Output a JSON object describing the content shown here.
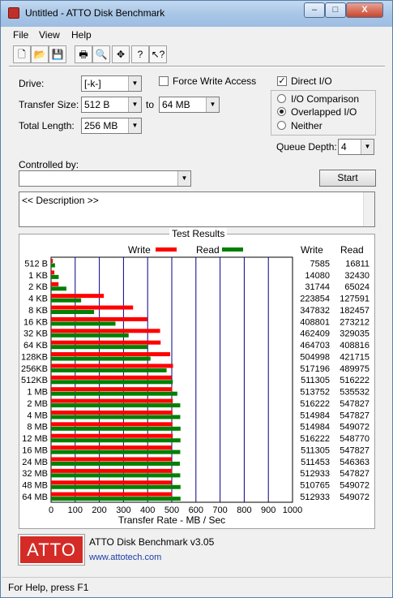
{
  "window": {
    "title": "Untitled - ATTO Disk Benchmark",
    "min": "–",
    "max": "□",
    "close": "X"
  },
  "menu": [
    "File",
    "View",
    "Help"
  ],
  "toolbar": [
    {
      "name": "new-icon",
      "glyph": "🗋"
    },
    {
      "name": "open-icon",
      "glyph": "📂"
    },
    {
      "name": "save-icon",
      "glyph": "💾"
    },
    {
      "name": "print-icon",
      "glyph": "🖶"
    },
    {
      "name": "print-preview-icon",
      "glyph": "🔍"
    },
    {
      "name": "move-icon",
      "glyph": "✥"
    },
    {
      "name": "help-icon",
      "glyph": "?"
    },
    {
      "name": "context-help-icon",
      "glyph": "↖?"
    }
  ],
  "settings": {
    "drive_label": "Drive:",
    "drive_value": "[-k-]",
    "force_write_label": "Force Write Access",
    "force_write_checked": false,
    "direct_io_label": "Direct I/O",
    "direct_io_checked": true,
    "transfer_size_label": "Transfer Size:",
    "transfer_from": "512 B",
    "to_label": "to",
    "transfer_to": "64 MB",
    "total_length_label": "Total Length:",
    "total_length": "256 MB",
    "radio_io_comparison": "I/O Comparison",
    "radio_overlapped": "Overlapped I/O",
    "radio_neither": "Neither",
    "selected_radio": "Overlapped I/O",
    "queue_depth_label": "Queue Depth:",
    "queue_depth": "4",
    "controlled_by_label": "Controlled by:",
    "controlled_by_value": "",
    "start_label": "Start",
    "description": "<< Description >>"
  },
  "results": {
    "title": "Test Results",
    "legend_write": "Write",
    "legend_read": "Read",
    "col_write": "Write",
    "col_read": "Read",
    "xlabel": "Transfer Rate - MB / Sec"
  },
  "chart_data": {
    "type": "bar",
    "orientation": "horizontal",
    "categories": [
      "512 B",
      "1 KB",
      "2 KB",
      "4 KB",
      "8 KB",
      "16 KB",
      "32 KB",
      "64 KB",
      "128KB",
      "256KB",
      "512KB",
      "1 MB",
      "2 MB",
      "4 MB",
      "8 MB",
      "12 MB",
      "16 MB",
      "24 MB",
      "32 MB",
      "48 MB",
      "64 MB"
    ],
    "series": [
      {
        "name": "Write",
        "color": "#ff0000",
        "values": [
          7585,
          14080,
          31744,
          223854,
          347832,
          408801,
          462409,
          464703,
          504998,
          517196,
          511305,
          513752,
          516222,
          514984,
          514984,
          516222,
          511305,
          511453,
          512933,
          510765,
          512933
        ]
      },
      {
        "name": "Read",
        "color": "#008000",
        "values": [
          16811,
          32430,
          65024,
          127591,
          182457,
          273212,
          329035,
          408816,
          421715,
          489975,
          516222,
          535532,
          547827,
          547827,
          549072,
          548770,
          547827,
          546363,
          547827,
          549072,
          549072
        ]
      }
    ],
    "xlabel": "Transfer Rate - MB / Sec",
    "xlim": [
      0,
      1000
    ],
    "xticks": [
      "0",
      "100",
      "200",
      "300",
      "400",
      "500",
      "600",
      "700",
      "800",
      "900",
      "1000"
    ],
    "bar_scale": "KB/s",
    "grid": true,
    "legend": "top"
  },
  "brand": {
    "logo": "ATTO",
    "name": "ATTO Disk Benchmark v3.05",
    "url": "www.attotech.com"
  },
  "status": "For Help, press F1",
  "colors": {
    "write": "#ff0000",
    "read": "#008000",
    "logo": "#d42b26",
    "grid": "#00008b"
  }
}
